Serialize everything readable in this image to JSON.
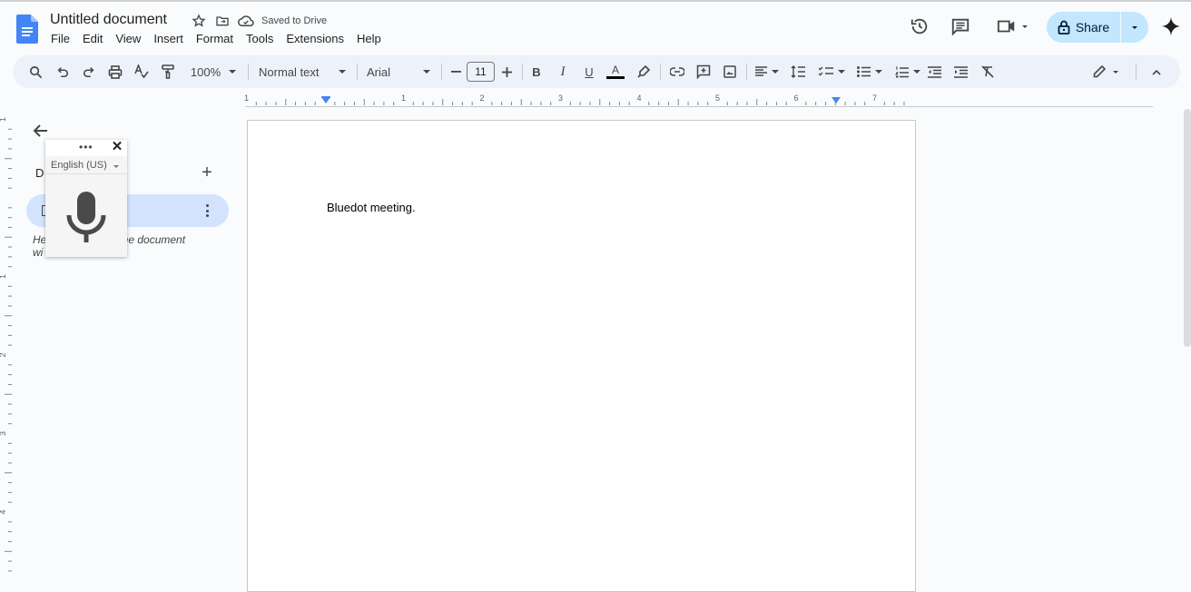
{
  "header": {
    "title": "Untitled document",
    "save_status": "Saved to Drive",
    "menu": [
      "File",
      "Edit",
      "View",
      "Insert",
      "Format",
      "Tools",
      "Extensions",
      "Help"
    ],
    "share_label": "Share",
    "icons": [
      "docs-logo-icon",
      "star-icon",
      "move-folder-icon",
      "cloud-saved-icon",
      "version-history-icon",
      "comments-icon",
      "meet-video-icon",
      "lock-icon",
      "gemini-sparkle-icon"
    ]
  },
  "toolbar": {
    "zoom": "100%",
    "style": "Normal text",
    "font": "Arial",
    "font_size": "11",
    "text_color": "#000000"
  },
  "ruler": {
    "h_labels": [
      "1",
      "1",
      "2",
      "3",
      "4",
      "5",
      "6",
      "7"
    ],
    "v_labels": [
      "1",
      "1",
      "2",
      "3",
      "4"
    ]
  },
  "sidebar": {
    "heading_fragment": "D",
    "hint_line1_start": "He",
    "hint_line1_end": "o the document",
    "hint_line2_start": "wi"
  },
  "voice_typing": {
    "language": "English (US)",
    "more_label": "•••",
    "close_label": "✕"
  },
  "document": {
    "body_text": "Bluedot meeting."
  }
}
